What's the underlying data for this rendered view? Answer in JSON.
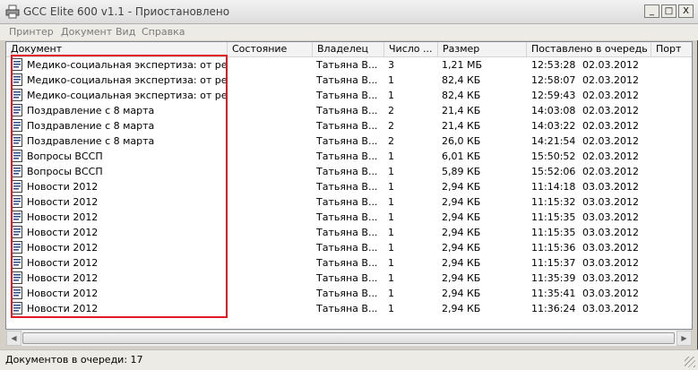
{
  "window": {
    "title": "GCC Elite 600 v1.1 - Приостановлено",
    "minimize_glyph": "_",
    "maximize_glyph": "□",
    "close_glyph": "X"
  },
  "menu": [
    {
      "label": "Принтер"
    },
    {
      "label": "Документ"
    },
    {
      "label": "Вид"
    },
    {
      "label": "Справка"
    }
  ],
  "columns": [
    {
      "label": "Документ"
    },
    {
      "label": "Состояние"
    },
    {
      "label": "Владелец"
    },
    {
      "label": "Число ..."
    },
    {
      "label": "Размер"
    },
    {
      "label": "Поставлено в очередь"
    },
    {
      "label": "Порт"
    }
  ],
  "rows": [
    {
      "document": "Медико-социальная экспертиза: от реф...",
      "status": "",
      "owner": "Татьяна В...",
      "pages": "3",
      "size": "1,21 МБ",
      "time": "12:53:28",
      "date": "02.03.2012",
      "port": ""
    },
    {
      "document": "Медико-социальная экспертиза: от реф...",
      "status": "",
      "owner": "Татьяна В...",
      "pages": "1",
      "size": "82,4 КБ",
      "time": "12:58:07",
      "date": "02.03.2012",
      "port": ""
    },
    {
      "document": "Медико-социальная экспертиза: от реф...",
      "status": "",
      "owner": "Татьяна В...",
      "pages": "1",
      "size": "82,4 КБ",
      "time": "12:59:43",
      "date": "02.03.2012",
      "port": ""
    },
    {
      "document": "Поздравление с 8 марта",
      "status": "",
      "owner": "Татьяна В...",
      "pages": "2",
      "size": "21,4 КБ",
      "time": "14:03:08",
      "date": "02.03.2012",
      "port": ""
    },
    {
      "document": "Поздравление с 8 марта",
      "status": "",
      "owner": "Татьяна В...",
      "pages": "2",
      "size": "21,4 КБ",
      "time": "14:03:22",
      "date": "02.03.2012",
      "port": ""
    },
    {
      "document": "Поздравление с 8 марта",
      "status": "",
      "owner": "Татьяна В...",
      "pages": "2",
      "size": "26,0 КБ",
      "time": "14:21:54",
      "date": "02.03.2012",
      "port": ""
    },
    {
      "document": "Вопросы ВССП",
      "status": "",
      "owner": "Татьяна В...",
      "pages": "1",
      "size": "6,01 КБ",
      "time": "15:50:52",
      "date": "02.03.2012",
      "port": ""
    },
    {
      "document": "Вопросы ВССП",
      "status": "",
      "owner": "Татьяна В...",
      "pages": "1",
      "size": "5,89 КБ",
      "time": "15:52:06",
      "date": "02.03.2012",
      "port": ""
    },
    {
      "document": "Новости 2012",
      "status": "",
      "owner": "Татьяна В...",
      "pages": "1",
      "size": "2,94 КБ",
      "time": "11:14:18",
      "date": "03.03.2012",
      "port": ""
    },
    {
      "document": "Новости 2012",
      "status": "",
      "owner": "Татьяна В...",
      "pages": "1",
      "size": "2,94 КБ",
      "time": "11:15:32",
      "date": "03.03.2012",
      "port": ""
    },
    {
      "document": "Новости 2012",
      "status": "",
      "owner": "Татьяна В...",
      "pages": "1",
      "size": "2,94 КБ",
      "time": "11:15:35",
      "date": "03.03.2012",
      "port": ""
    },
    {
      "document": "Новости 2012",
      "status": "",
      "owner": "Татьяна В...",
      "pages": "1",
      "size": "2,94 КБ",
      "time": "11:15:35",
      "date": "03.03.2012",
      "port": ""
    },
    {
      "document": "Новости 2012",
      "status": "",
      "owner": "Татьяна В...",
      "pages": "1",
      "size": "2,94 КБ",
      "time": "11:15:36",
      "date": "03.03.2012",
      "port": ""
    },
    {
      "document": "Новости 2012",
      "status": "",
      "owner": "Татьяна В...",
      "pages": "1",
      "size": "2,94 КБ",
      "time": "11:15:37",
      "date": "03.03.2012",
      "port": ""
    },
    {
      "document": "Новости 2012",
      "status": "",
      "owner": "Татьяна В...",
      "pages": "1",
      "size": "2,94 КБ",
      "time": "11:35:39",
      "date": "03.03.2012",
      "port": ""
    },
    {
      "document": "Новости 2012",
      "status": "",
      "owner": "Татьяна В...",
      "pages": "1",
      "size": "2,94 КБ",
      "time": "11:35:41",
      "date": "03.03.2012",
      "port": ""
    },
    {
      "document": "Новости 2012",
      "status": "",
      "owner": "Татьяна В...",
      "pages": "1",
      "size": "2,94 КБ",
      "time": "11:36:24",
      "date": "03.03.2012",
      "port": ""
    }
  ],
  "scrollbar": {
    "left_glyph": "◀",
    "right_glyph": "▶"
  },
  "status": {
    "text": "Документов в очереди: 17"
  },
  "icons": {
    "title": "printer-icon",
    "row": "document-icon"
  },
  "colors": {
    "highlight_box": "#e01b24",
    "titlebar": "#e6e6e6",
    "window_bg": "#d4d0c8"
  }
}
